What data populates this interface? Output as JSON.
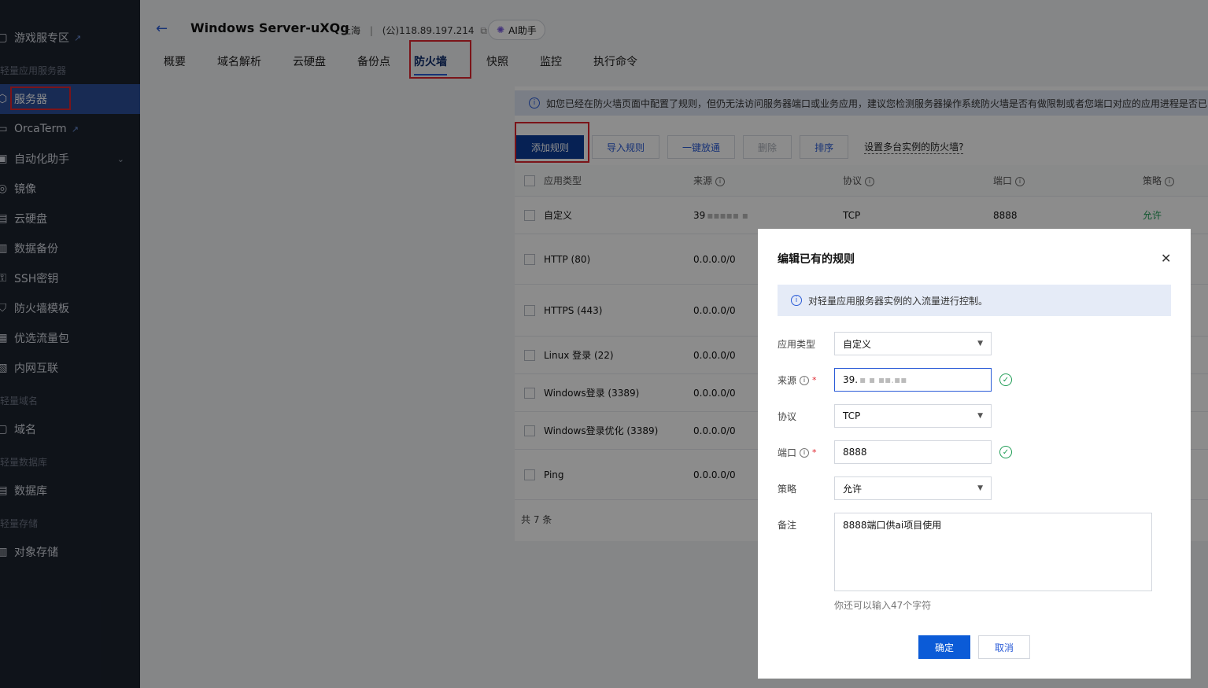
{
  "sidebar": {
    "items": [
      {
        "label": "游戏服专区",
        "icon": "gamepad-icon",
        "external": true
      },
      {
        "label": "服务器",
        "icon": "server-icon",
        "active": true
      },
      {
        "label": "OrcaTerm",
        "icon": "terminal-icon",
        "external": true
      },
      {
        "label": "自动化助手",
        "icon": "robot-icon",
        "expandable": true
      },
      {
        "label": "镜像",
        "icon": "image-icon"
      },
      {
        "label": "云硬盘",
        "icon": "disk-icon"
      },
      {
        "label": "数据备份",
        "icon": "backup-icon"
      },
      {
        "label": "SSH密钥",
        "icon": "key-icon"
      },
      {
        "label": "防火墙模板",
        "icon": "shield-icon"
      },
      {
        "label": "优选流量包",
        "icon": "traffic-icon"
      },
      {
        "label": "内网互联",
        "icon": "network-icon"
      },
      {
        "label": "域名",
        "icon": "domain-icon"
      },
      {
        "label": "数据库",
        "icon": "database-icon"
      },
      {
        "label": "对象存储",
        "icon": "storage-icon"
      }
    ],
    "groups": [
      "轻量应用服务器",
      "轻量域名",
      "轻量数据库",
      "轻量存储"
    ]
  },
  "header": {
    "title": "Windows Server-uXQg",
    "region": "上海",
    "separator": "|",
    "ip": "(公)118.89.197.214",
    "ai_label": "AI助手",
    "tabs": [
      "概要",
      "域名解析",
      "云硬盘",
      "备份点",
      "防火墙",
      "快照",
      "监控",
      "执行命令"
    ]
  },
  "notice": "如您已经在防火墙页面中配置了规则，但仍无法访问服务器端口或业务应用，建议您检测服务器操作系统防火墙是否有做限制或者您端口对应的应用进程是否已",
  "toolbar": {
    "add": "添加规则",
    "import": "导入规则",
    "open_all": "一键放通",
    "delete": "删除",
    "sort": "排序",
    "multi": "设置多台实例的防火墙?"
  },
  "table": {
    "headers": [
      "应用类型",
      "来源",
      "协议",
      "端口",
      "策略"
    ],
    "rows": [
      {
        "type": "自定义",
        "source": "39",
        "protocol": "TCP",
        "port": "8888",
        "policy": "允许"
      },
      {
        "type": "HTTP (80)",
        "source": "0.0.0.0/0"
      },
      {
        "type": "HTTPS (443)",
        "source": "0.0.0.0/0"
      },
      {
        "type": "Linux 登录 (22)",
        "source": "0.0.0.0/0"
      },
      {
        "type": "Windows登录 (3389)",
        "source": "0.0.0.0/0"
      },
      {
        "type": "Windows登录优化 (3389)",
        "source": "0.0.0.0/0"
      },
      {
        "type": "Ping",
        "source": "0.0.0.0/0"
      }
    ],
    "total": "共 7 条"
  },
  "modal": {
    "title": "编辑已有的规则",
    "info": "对轻量应用服务器实例的入流量进行控制。",
    "fields": {
      "type_label": "应用类型",
      "type_value": "自定义",
      "source_label": "来源",
      "source_value": "39.",
      "protocol_label": "协议",
      "protocol_value": "TCP",
      "port_label": "端口",
      "port_value": "8888",
      "policy_label": "策略",
      "policy_value": "允许",
      "remark_label": "备注",
      "remark_value": "8888端口供ai项目使用",
      "remark_hint": "你还可以输入47个字符"
    },
    "confirm": "确定",
    "cancel": "取消"
  },
  "colors": {
    "accent": "#2a5bd7",
    "primary_button": "#0b5bd7",
    "highlight_box": "#e0262f",
    "allow": "#1f9d55"
  }
}
